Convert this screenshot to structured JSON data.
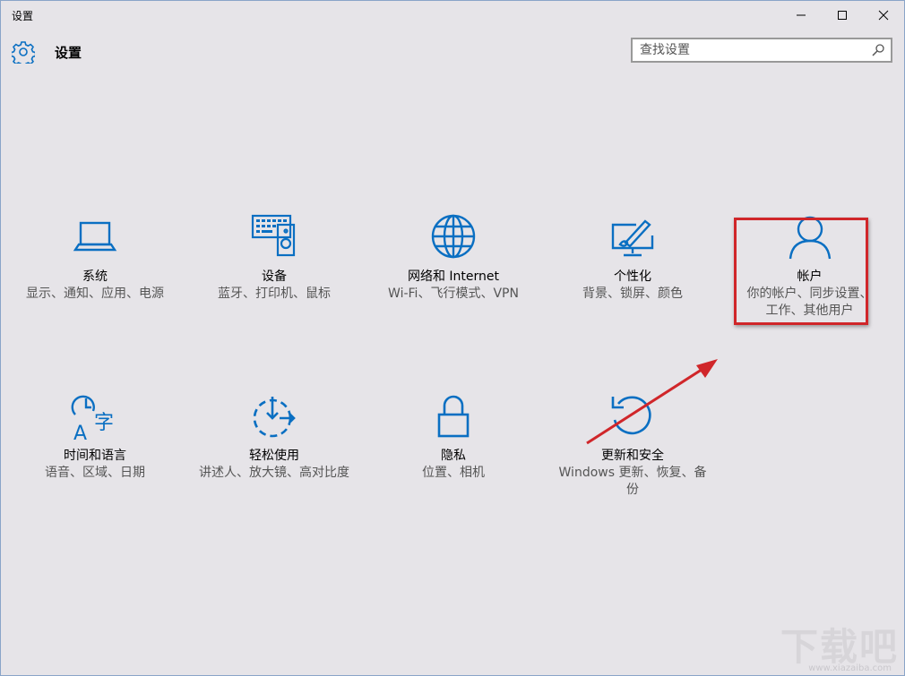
{
  "window": {
    "title": "设置",
    "heading": "设置",
    "controls": {
      "minimize": "—",
      "maximize": "☐",
      "close": "✕"
    }
  },
  "search": {
    "placeholder": "查找设置",
    "value": ""
  },
  "tiles": [
    {
      "name": "系统",
      "desc": "显示、通知、应用、电源",
      "icon": "laptop-icon"
    },
    {
      "name": "设备",
      "desc": "蓝牙、打印机、鼠标",
      "icon": "devices-icon"
    },
    {
      "name": "网络和 Internet",
      "desc": "Wi-Fi、飞行模式、VPN",
      "icon": "globe-icon"
    },
    {
      "name": "个性化",
      "desc": "背景、锁屏、颜色",
      "icon": "paintbrush-icon"
    },
    {
      "name": "帐户",
      "desc": "你的帐户、同步设置、工作、其他用户",
      "icon": "person-icon"
    },
    {
      "name": "时间和语言",
      "desc": "语音、区域、日期",
      "icon": "time-language-icon"
    },
    {
      "name": "轻松使用",
      "desc": "讲述人、放大镜、高对比度",
      "icon": "ease-of-access-icon"
    },
    {
      "name": "隐私",
      "desc": "位置、相机",
      "icon": "lock-icon"
    },
    {
      "name": "更新和安全",
      "desc": "Windows 更新、恢复、备份",
      "icon": "refresh-icon"
    }
  ],
  "annotation": {
    "highlight_color": "#d0262a",
    "arrow_color": "#d0262a"
  },
  "watermark": {
    "text": "下载吧",
    "url": "www.xiazaiba.com"
  },
  "colors": {
    "accent": "#0a6fc2",
    "background": "#e6e4e8"
  }
}
